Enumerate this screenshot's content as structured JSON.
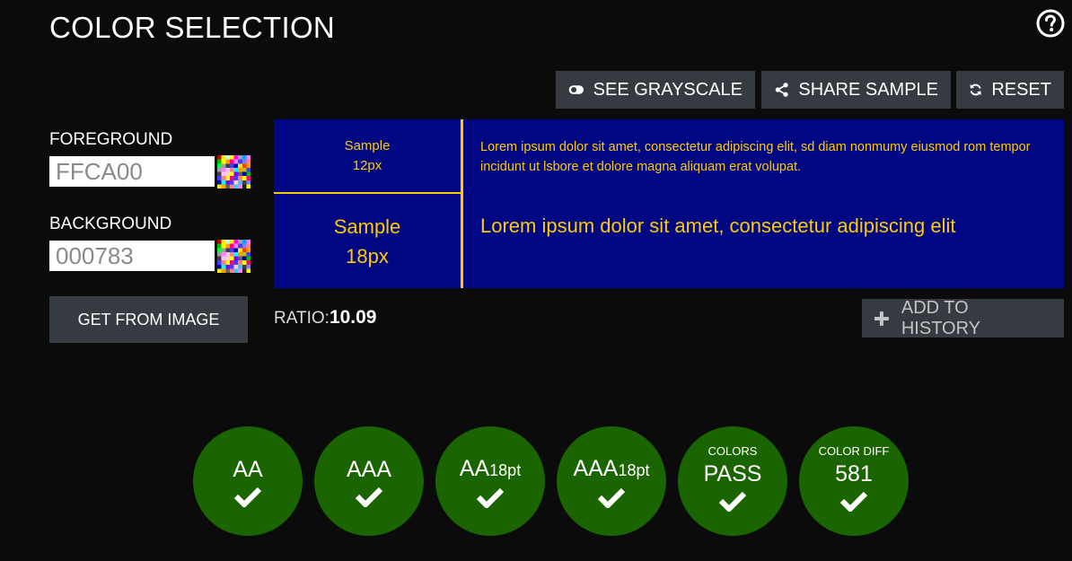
{
  "header": {
    "title": "COLOR SELECTION",
    "help_icon": "question-circle-icon"
  },
  "toolbar": {
    "grayscale_label": "SEE GRAYSCALE",
    "share_label": "SHARE SAMPLE",
    "reset_label": "RESET"
  },
  "foreground": {
    "label": "FOREGROUND",
    "value": "FFCA00",
    "palette_icon": "color-palette-icon"
  },
  "background": {
    "label": "BACKGROUND",
    "value": "000783",
    "palette_icon": "color-palette-icon"
  },
  "get_from_image_label": "GET FROM IMAGE",
  "sample": {
    "small_label": "Sample",
    "small_size": "12px",
    "large_label": "Sample",
    "large_size": "18px",
    "small_text": "Lorem ipsum dolor sit amet, consectetur adipiscing elit, sd diam nonmumy eiusmod rom tempor incidunt ut lsbore et dolore magna aliquam erat volupat.",
    "large_text": "Lorem ipsum dolor sit amet, consectetur adipiscing elit"
  },
  "ratio": {
    "label": "RATIO:",
    "value": "10.09"
  },
  "add_history_label": "ADD TO HISTORY",
  "results": [
    {
      "main": "AA",
      "sub": "",
      "sup": ""
    },
    {
      "main": "AAA",
      "sub": "",
      "sup": ""
    },
    {
      "main": "AA",
      "sub": "18pt",
      "sup": ""
    },
    {
      "main": "AAA",
      "sub": "18pt",
      "sup": ""
    },
    {
      "main": "PASS",
      "sub": "",
      "sup": "COLORS"
    },
    {
      "main": "581",
      "sub": "",
      "sup": "COLOR DIFF"
    }
  ],
  "colors": {
    "foreground": "#FFCA00",
    "background": "#000783",
    "divider": "#FFCA00",
    "pass_green": "#1a6500",
    "button_bg": "#363b42"
  }
}
